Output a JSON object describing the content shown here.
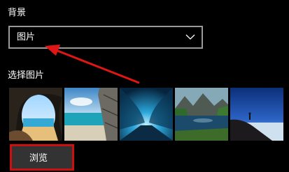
{
  "background": {
    "section_label": "背景",
    "dropdown": {
      "selected_value": "图片",
      "icon": "chevron-down-icon"
    }
  },
  "choose_picture": {
    "section_label": "选择图片",
    "thumbnails": [
      {
        "name": "thumbnail-sea-cave"
      },
      {
        "name": "thumbnail-beach-rock"
      },
      {
        "name": "thumbnail-ice-cave"
      },
      {
        "name": "thumbnail-mountain-lake"
      },
      {
        "name": "thumbnail-night-sky-sea"
      }
    ]
  },
  "browse": {
    "button_label": "浏览"
  },
  "annotations": {
    "arrow_color": "#e01515",
    "highlight_color": "#cc1010"
  }
}
